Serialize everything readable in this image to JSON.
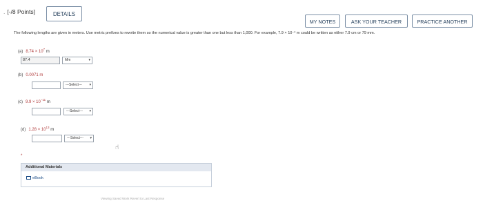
{
  "header": {
    "points": "[-/8 Points]",
    "details_label": "DETAILS",
    "my_notes_label": "MY NOTES",
    "ask_teacher_label": "ASK YOUR TEACHER",
    "practice_label": "PRACTICE ANOTHER"
  },
  "question": {
    "text": "The following lengths are given in meters. Use metric prefixes to rewrite them so the numerical value is greater than one but less than 1,000. For example, 7.9 × 10⁻² m could be written as either 7.9 cm or 79 mm."
  },
  "parts": [
    {
      "label": "(a)",
      "value": "8.74 × 10",
      "exp": "7",
      "unit": "m",
      "input_value": "87.4",
      "select_value": "Mm"
    },
    {
      "label": "(b)",
      "value": "0.0071 m",
      "exp": "",
      "unit": "",
      "input_value": "",
      "select_value": "---Select---"
    },
    {
      "label": "(c)",
      "value": "9.9 × 10",
      "exp": "−11",
      "unit": "m",
      "input_value": "",
      "select_value": "---Select---"
    },
    {
      "label": "(d)",
      "value": "1.28 × 10",
      "exp": "13",
      "unit": "m",
      "input_value": "",
      "select_value": "---Select---"
    }
  ],
  "additional": {
    "title": "Additional Materials",
    "ebook_label": "eBook"
  },
  "footer": {
    "text": "Viewing Saved Work Revert to Last Response"
  },
  "icons": {
    "select_caret": "chevron-down-icon",
    "cursor": "hand-pointer-icon",
    "ebook": "book-icon"
  }
}
